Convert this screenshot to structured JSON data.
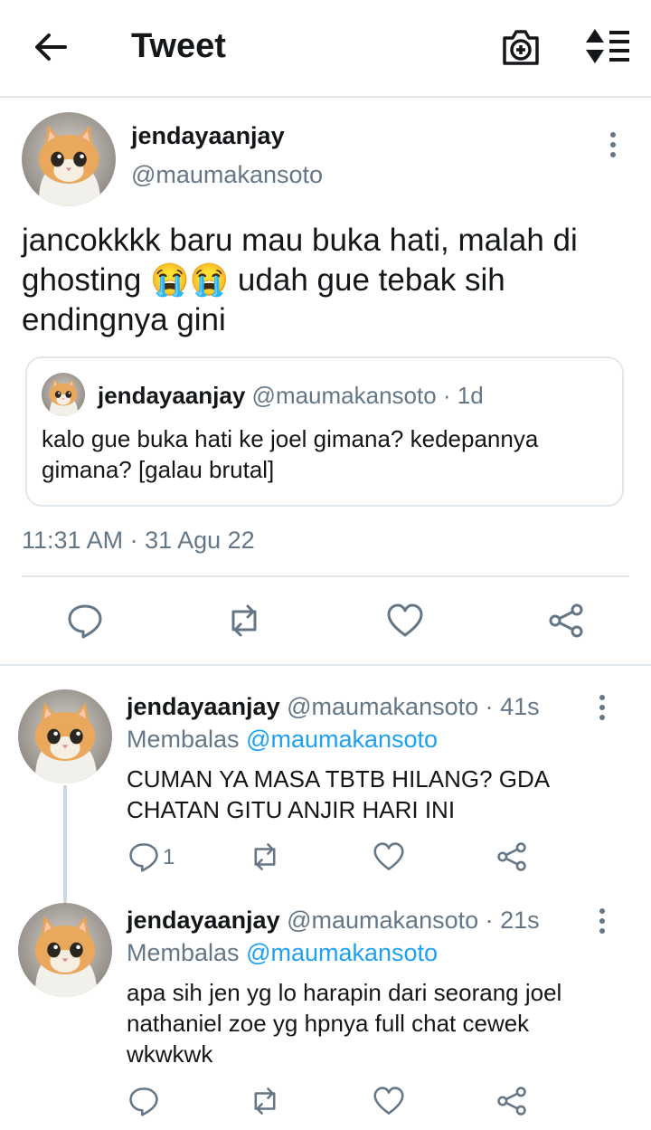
{
  "header": {
    "title": "Tweet",
    "back_icon": "arrow-left-icon",
    "camera_icon": "camera-plus-icon",
    "sort_icon": "sort-lines-icon"
  },
  "main_tweet": {
    "author_name": "jendayaanjay",
    "author_handle": "@maumakansoto",
    "text": "jancokkkk baru mau buka hati, malah di ghosting 😭😭 udah gue tebak sih endingnya gini",
    "timestamp": "11:31 AM · 31 Agu 22",
    "quoted": {
      "author_name": "jendayaanjay",
      "meta": "@maumakansoto · 1d",
      "text": "kalo gue buka hati ke joel gimana? kedepannya gimana? [galau brutal]"
    }
  },
  "replies": [
    {
      "author_name": "jendayaanjay",
      "meta": "@maumakansoto · 41s",
      "replying_label": "Membalas",
      "replying_to": "@maumakansoto",
      "text": "CUMAN YA MASA TBTB HILANG? GDA CHATAN GITU ANJIR HARI INI",
      "reply_count": "1"
    },
    {
      "author_name": "jendayaanjay",
      "meta": "@maumakansoto · 21s",
      "replying_label": "Membalas",
      "replying_to": "@maumakansoto",
      "text": "apa sih jen yg lo harapin dari seorang joel nathaniel zoe yg hpnya full chat cewek wkwkwk",
      "reply_count": ""
    }
  ],
  "colors": {
    "accent": "#1da1f2",
    "muted": "#657786",
    "border": "#e1e8ed"
  }
}
